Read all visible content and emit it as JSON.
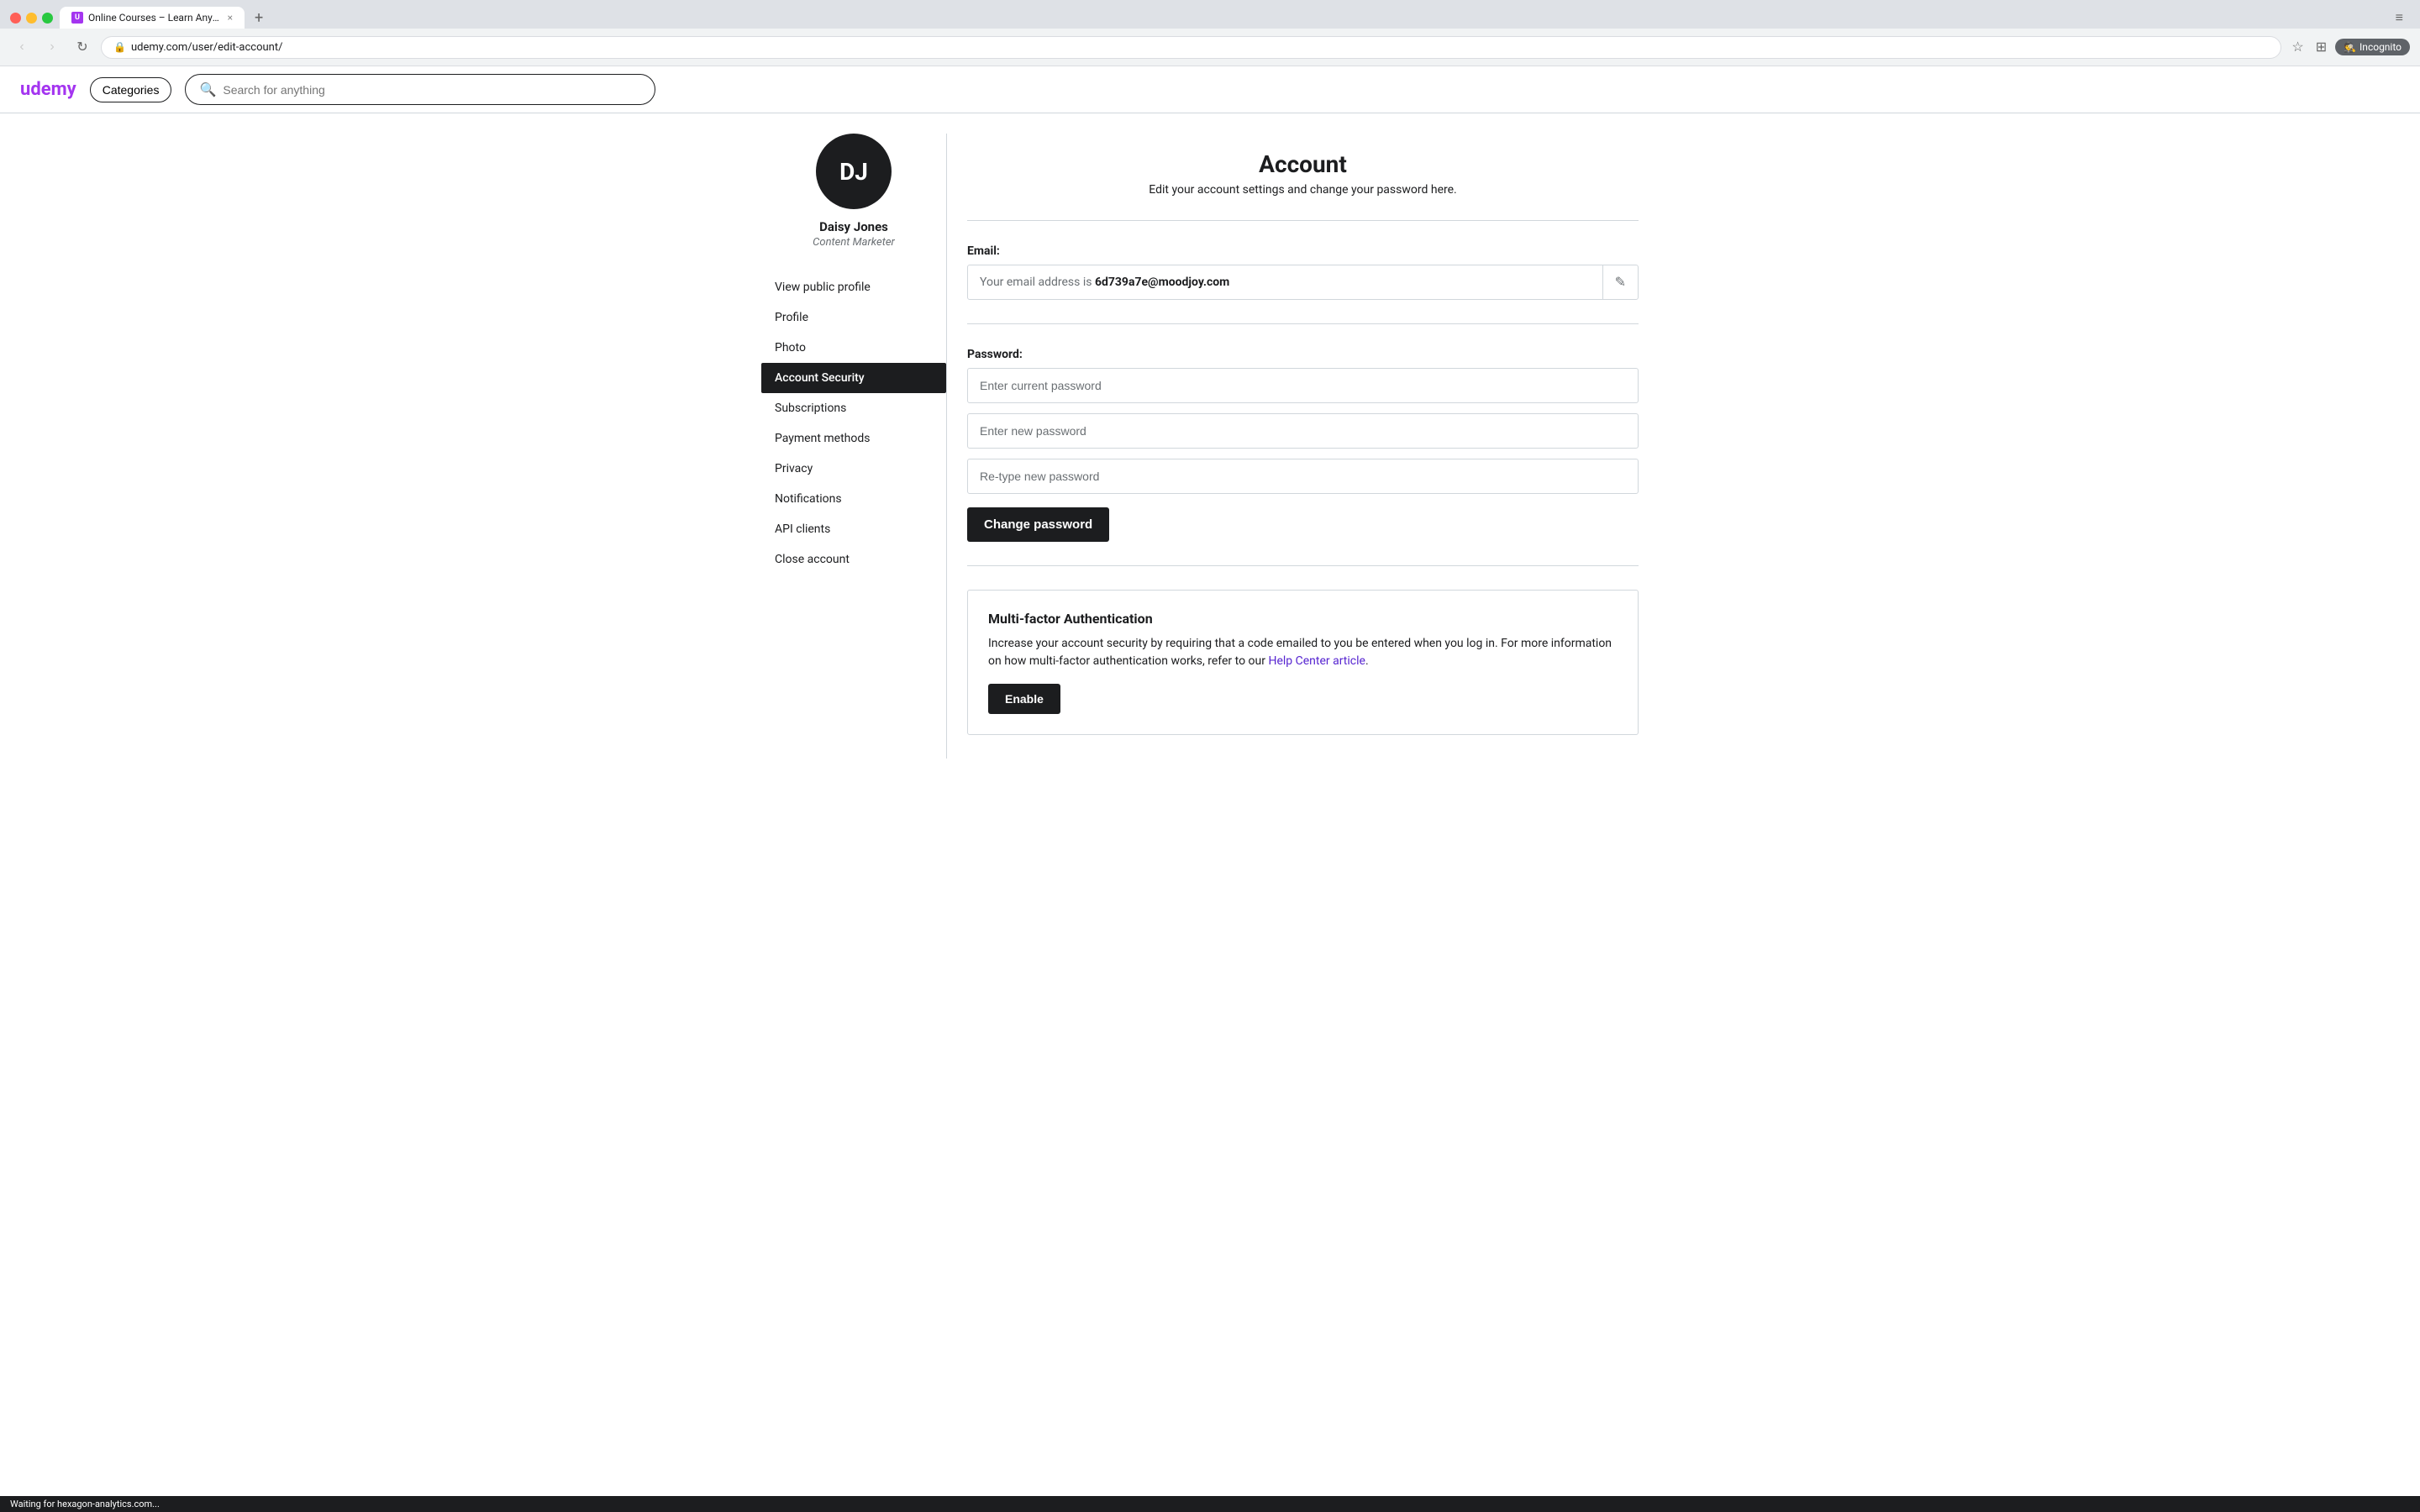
{
  "browser": {
    "tab": {
      "favicon_text": "U",
      "title": "Online Courses – Learn Anyth...",
      "close_label": "×"
    },
    "new_tab_label": "+",
    "tab_menu_label": "≡",
    "nav": {
      "back_label": "‹",
      "forward_label": "›",
      "reload_label": "↻"
    },
    "url": {
      "lock_icon": "🔒",
      "text": "udemy.com/user/edit-account/"
    },
    "toolbar": {
      "star_label": "☆",
      "grid_label": "⊞",
      "incognito_label": "Incognito"
    }
  },
  "header": {
    "logo": "udemy",
    "categories_label": "Categories",
    "search_placeholder": "Search for anything"
  },
  "sidebar": {
    "avatar_initials": "DJ",
    "user_name": "Daisy Jones",
    "user_title": "Content Marketer",
    "nav_items": [
      {
        "id": "view-public-profile",
        "label": "View public profile",
        "active": false
      },
      {
        "id": "profile",
        "label": "Profile",
        "active": false
      },
      {
        "id": "photo",
        "label": "Photo",
        "active": false
      },
      {
        "id": "account-security",
        "label": "Account Security",
        "active": true
      },
      {
        "id": "subscriptions",
        "label": "Subscriptions",
        "active": false
      },
      {
        "id": "payment-methods",
        "label": "Payment methods",
        "active": false
      },
      {
        "id": "privacy",
        "label": "Privacy",
        "active": false
      },
      {
        "id": "notifications",
        "label": "Notifications",
        "active": false
      },
      {
        "id": "api-clients",
        "label": "API clients",
        "active": false
      },
      {
        "id": "close-account",
        "label": "Close account",
        "active": false
      }
    ]
  },
  "main": {
    "title": "Account",
    "subtitle": "Edit your account settings and change your password here.",
    "email": {
      "label": "Email:",
      "prefix": "Your email address is ",
      "address": "6d739a7e@moodjoy.com",
      "edit_icon": "✎"
    },
    "password": {
      "label": "Password:",
      "current_placeholder": "Enter current password",
      "new_placeholder": "Enter new password",
      "retype_placeholder": "Re-type new password",
      "change_button_label": "Change password"
    },
    "mfa": {
      "title": "Multi-factor Authentication",
      "description_part1": "Increase your account security by requiring that a code emailed to you be entered when you log in. For more information on how multi-factor authentication works, refer to our ",
      "link_text": "Help Center article",
      "description_part2": ".",
      "enable_button_label": "Enable"
    }
  },
  "status_bar": {
    "text": "Waiting for hexagon-analytics.com..."
  }
}
